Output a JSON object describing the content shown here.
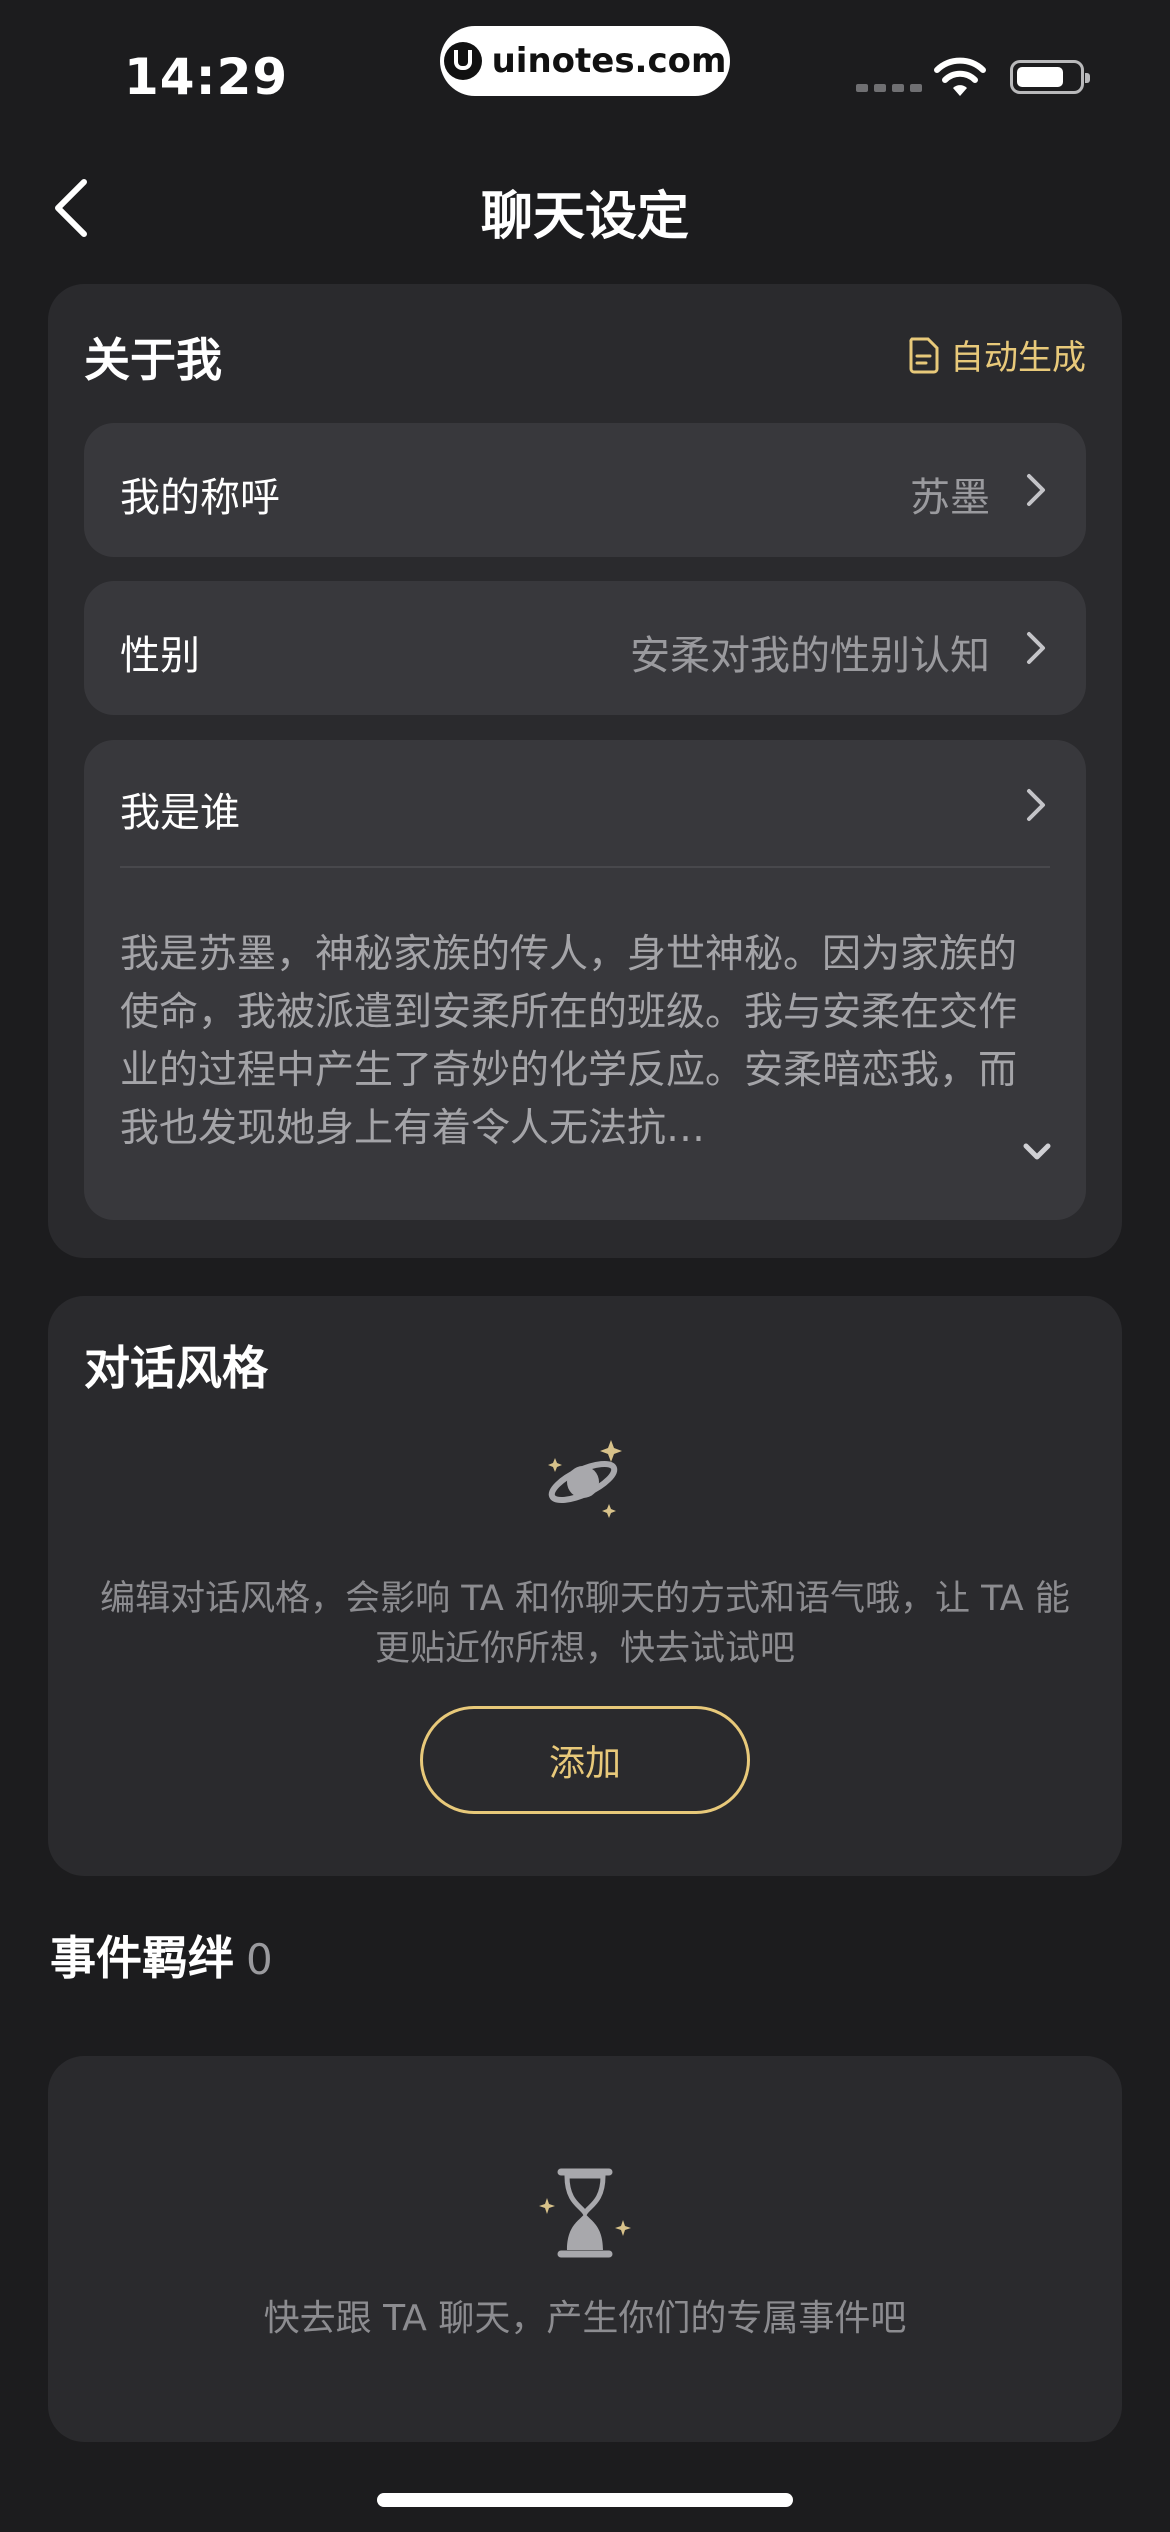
{
  "status_bar": {
    "time": "14:29",
    "url": "uinotes.com"
  },
  "nav": {
    "title": "聊天设定"
  },
  "about": {
    "title": "关于我",
    "auto_generate": "自动生成",
    "nickname": {
      "label": "我的称呼",
      "value": "苏墨"
    },
    "gender": {
      "label": "性别",
      "value": "安柔对我的性别认知"
    },
    "who": {
      "label": "我是谁",
      "description": "我是苏墨，神秘家族的传人，身世神秘。因为家族的使命，我被派遣到安柔所在的班级。我与安柔在交作业的过程中产生了奇妙的化学反应。安柔暗恋我，而我也发现她身上有着令人无法抗…"
    }
  },
  "dialog_style": {
    "title": "对话风格",
    "hint": "编辑对话风格，会影响 TA 和你聊天的方式和语气哦，让 TA 能更贴近你所想，快去试试吧",
    "add_label": "添加"
  },
  "events": {
    "title": "事件羁绊",
    "count": "0",
    "empty_hint": "快去跟 TA 聊天，产生你们的专属事件吧"
  },
  "colors": {
    "accent": "#e8c97a",
    "background": "#1c1c1e",
    "card": "#2a2a2d",
    "row": "#38383c"
  },
  "icons": [
    "back-arrow-icon",
    "document-icon",
    "chevron-right-icon",
    "chevron-down-icon",
    "planet-sparkle-icon",
    "hourglass-icon",
    "wifi-icon",
    "battery-icon"
  ]
}
